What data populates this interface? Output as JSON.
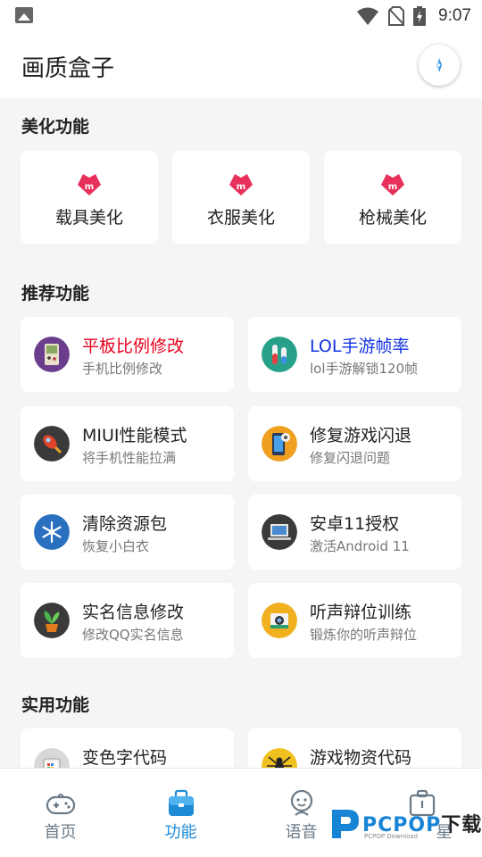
{
  "status_bar": {
    "time": "9:07",
    "icons": [
      "photo-icon",
      "wifi-icon",
      "no-sim-icon",
      "battery-charging-icon"
    ]
  },
  "app_bar": {
    "title": "画质盒子",
    "action_icon": "compass-icon"
  },
  "sections": {
    "beauty": {
      "title": "美化功能",
      "items": [
        {
          "label": "载具美化",
          "icon": "m-badge-icon"
        },
        {
          "label": "衣服美化",
          "icon": "m-badge-icon"
        },
        {
          "label": "枪械美化",
          "icon": "m-badge-icon"
        }
      ]
    },
    "recommended": {
      "title": "推荐功能",
      "items": [
        {
          "title": "平板比例修改",
          "subtitle": "手机比例修改",
          "icon": "gameboy-icon",
          "title_color": "#e8001c"
        },
        {
          "title": "LOL手游帧率",
          "subtitle": "lol手游解锁120帧",
          "icon": "test-tubes-icon",
          "title_color": "#1030e0"
        },
        {
          "title": "MIUI性能模式",
          "subtitle": "将手机性能拉满",
          "icon": "rocket-icon",
          "title_color": "#222222"
        },
        {
          "title": "修复游戏闪退",
          "subtitle": "修复闪退问题",
          "icon": "phone-settings-icon",
          "title_color": "#222222"
        },
        {
          "title": "清除资源包",
          "subtitle": "恢复小白衣",
          "icon": "snowflake-icon",
          "title_color": "#222222"
        },
        {
          "title": "安卓11授权",
          "subtitle": "激活Android 11",
          "icon": "laptop-icon",
          "title_color": "#222222"
        },
        {
          "title": "实名信息修改",
          "subtitle": "修改QQ实名信息",
          "icon": "plant-icon",
          "title_color": "#222222"
        },
        {
          "title": "听声辩位训练",
          "subtitle": "锻炼你的听声辩位",
          "icon": "camera-icon",
          "title_color": "#222222"
        }
      ]
    },
    "practical": {
      "title": "实用功能",
      "items": [
        {
          "title": "变色字代码",
          "icon": "robot-icon",
          "title_color": "#222222"
        },
        {
          "title": "游戏物资代码",
          "icon": "spider-icon",
          "title_color": "#222222"
        }
      ]
    }
  },
  "bottom_nav": {
    "active": "功能",
    "items": [
      {
        "label": "首页",
        "icon": "gamepad-icon"
      },
      {
        "label": "功能",
        "icon": "briefcase-icon"
      },
      {
        "label": "语音",
        "icon": "voice-icon"
      },
      {
        "label": "星",
        "icon": "toolbox-icon"
      }
    ]
  },
  "watermark": {
    "brand": "PCPOP",
    "suffix": "下载",
    "sub": "PCPOP Download"
  },
  "colors": {
    "accent_blue": "#1f8bd6",
    "nav_inactive": "#6b7a86",
    "badge_pink": "#e8315a"
  }
}
